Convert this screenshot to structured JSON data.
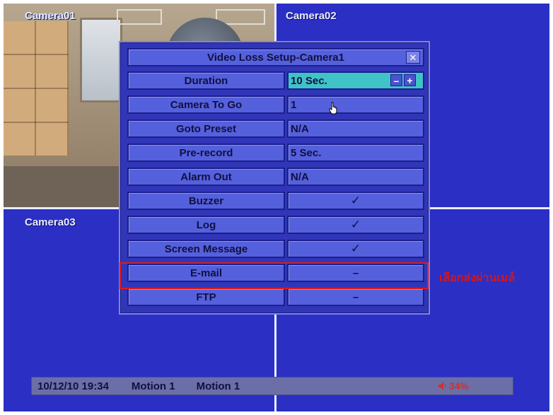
{
  "cameras": [
    {
      "label": "Camera01"
    },
    {
      "label": "Camera02"
    },
    {
      "label": "Camera03"
    }
  ],
  "dialog": {
    "title": "Video Loss Setup-Camera1",
    "close_icon": "close-icon",
    "rows": [
      {
        "label": "Duration",
        "value": "10 Sec.",
        "type": "stepper"
      },
      {
        "label": "Camera To Go",
        "value": "1",
        "type": "text"
      },
      {
        "label": "Goto Preset",
        "value": "N/A",
        "type": "text"
      },
      {
        "label": "Pre-record",
        "value": "5 Sec.",
        "type": "text"
      },
      {
        "label": "Alarm Out",
        "value": "N/A",
        "type": "text"
      },
      {
        "label": "Buzzer",
        "value": "✓",
        "type": "check"
      },
      {
        "label": "Log",
        "value": "✓",
        "type": "check"
      },
      {
        "label": "Screen Message",
        "value": "✓",
        "type": "check"
      },
      {
        "label": "E-mail",
        "value": "–",
        "type": "dash"
      },
      {
        "label": "FTP",
        "value": "–",
        "type": "dash"
      }
    ],
    "stepper": {
      "minus": "–",
      "plus": "+"
    }
  },
  "annotation": {
    "text": "เลือกส่งผ่านเมล์",
    "color": "#d81515"
  },
  "statusbar": {
    "datetime": "10/12/10 19:34",
    "status1": "Motion 1",
    "status2": "Motion 1",
    "volume": "34%"
  },
  "colors": {
    "background": "#2b2fc4",
    "cell": "#5560dc",
    "highlight": "#3fc3c7",
    "annotation": "#d81515"
  }
}
